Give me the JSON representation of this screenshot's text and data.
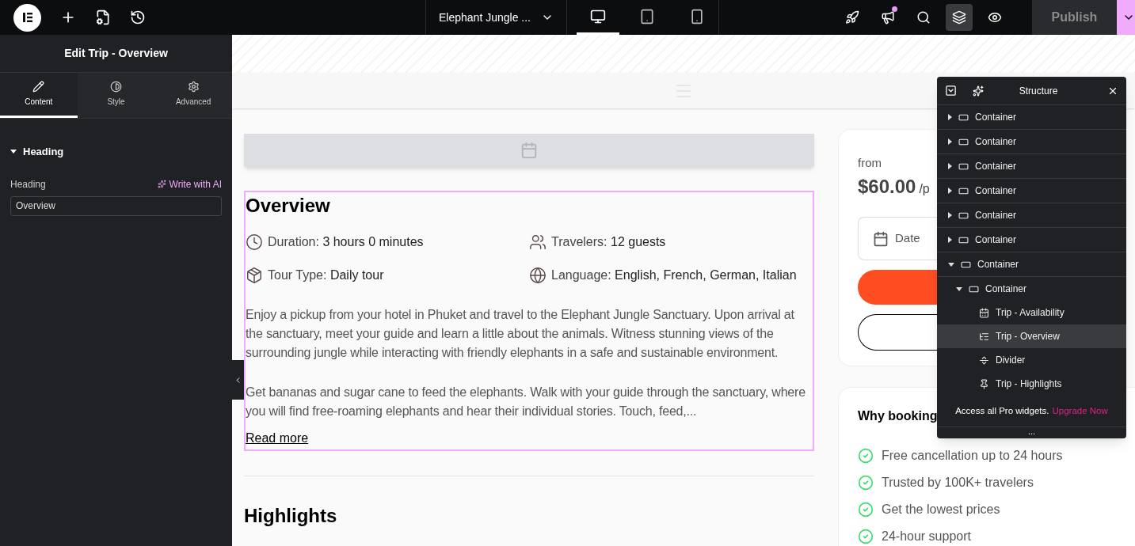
{
  "topbar": {
    "site_title": "Elephant Jungle ...",
    "devices": [
      {
        "kind": "desktop",
        "selected": true
      },
      {
        "kind": "tablet",
        "selected": false
      },
      {
        "kind": "mobile",
        "selected": false
      }
    ],
    "tools": [
      {
        "kind": "rocket",
        "selected": false,
        "badge": false
      },
      {
        "kind": "megaphone",
        "selected": false,
        "badge": true
      },
      {
        "kind": "search",
        "selected": false,
        "badge": false
      },
      {
        "kind": "layers",
        "selected": true,
        "badge": false
      },
      {
        "kind": "preview",
        "selected": false,
        "badge": false
      }
    ],
    "publish": "Publish"
  },
  "panel": {
    "title": "Edit Trip - Overview",
    "tabs": [
      {
        "kind": "content",
        "label": "Content",
        "selected": true
      },
      {
        "kind": "style",
        "label": "Style",
        "selected": false
      },
      {
        "kind": "advanced",
        "label": "Advanced",
        "selected": false
      }
    ],
    "section": {
      "title": "Heading",
      "expanded": true
    },
    "field": {
      "label": "Heading",
      "ai_link": "Write with AI",
      "value": "Overview"
    }
  },
  "content": {
    "heading": "Overview",
    "facts": [
      {
        "kind": "duration",
        "label": "Duration:",
        "value": "3 hours 0 minutes"
      },
      {
        "kind": "travelers",
        "label": "Travelers:",
        "value": "12 guests"
      },
      {
        "kind": "tour",
        "label": "Tour Type:",
        "value": "Daily tour"
      },
      {
        "kind": "language",
        "label": "Language:",
        "value": "English, French, German, Italian"
      }
    ],
    "paragraphs": [
      "Enjoy a pickup from your hotel in Phuket and travel to the Elephant Jungle Sanctuary. Upon arrival at the sanctuary, meet your guide and learn a little about the animals. Witness stunning views of the surrounding jungle while interacting with friendly elephants in a safe and sustainable environment.",
      "Get bananas and sugar cane to feed the elephants. Walk with your guide through the sanctuary, where you will find free-roaming elephants and hear their individual stories. Touch, feed,..."
    ],
    "read_more": "Read more",
    "next_heading": "Highlights"
  },
  "booking": {
    "from": "from",
    "price": "$60.00",
    "per": "/p",
    "date": "Date"
  },
  "why": {
    "title": "Why booking",
    "benefits": [
      "Free cancellation up to 24 hours",
      "Trusted by 100K+ travelers",
      "Get the lowest prices",
      "24-hour support"
    ]
  },
  "structure": {
    "title": "Structure",
    "tree": [
      {
        "kind": "container",
        "label": "Container",
        "expanded": false,
        "selected": false
      },
      {
        "kind": "container",
        "label": "Container",
        "expanded": false,
        "selected": false
      },
      {
        "kind": "container",
        "label": "Container",
        "expanded": false,
        "selected": false
      },
      {
        "kind": "container",
        "label": "Container",
        "expanded": false,
        "selected": false
      },
      {
        "kind": "container",
        "label": "Container",
        "expanded": false,
        "selected": false
      },
      {
        "kind": "container",
        "label": "Container",
        "expanded": false,
        "selected": false
      },
      {
        "kind": "container",
        "label": "Container",
        "expanded": true,
        "selected": false,
        "children": [
          {
            "kind": "container",
            "label": "Container",
            "expanded": true,
            "selected": false,
            "children": [
              {
                "kind": "availability",
                "label": "Trip - Availability",
                "selected": false
              },
              {
                "kind": "overview",
                "label": "Trip - Overview",
                "selected": true
              },
              {
                "kind": "divider",
                "label": "Divider",
                "selected": false
              },
              {
                "kind": "highlights",
                "label": "Trip - Highlights",
                "selected": false
              }
            ]
          }
        ]
      }
    ],
    "promo": "Access all Pro widgets.",
    "upgrade": "Upgrade Now",
    "more": "..."
  }
}
